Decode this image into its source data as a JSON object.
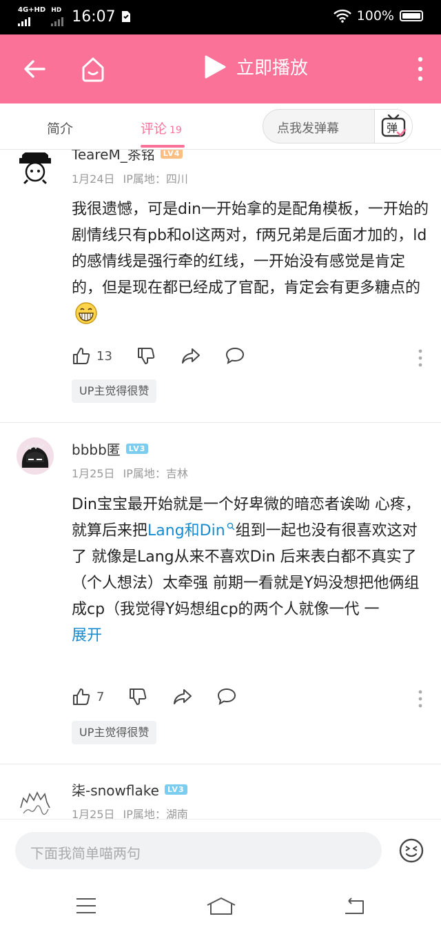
{
  "status_bar": {
    "network_label": "4G+HD",
    "network2_label": "HD",
    "time": "16:07",
    "battery": "100%"
  },
  "app_bar": {
    "play_label": "立即播放"
  },
  "tabs": {
    "intro": "简介",
    "comments": "评论",
    "comment_count": "19",
    "danmaku_placeholder": "点我发弹幕",
    "danmaku_icon_label": "弹"
  },
  "comments": [
    {
      "username": "TeareM_茶铭",
      "level": "LV4",
      "level_color": "#fcbf83",
      "date": "1月24日",
      "ip": "IP属地：四川",
      "text": "我很遗憾，可是din一开始拿的是配角模板，一开始的剧情线只有pb和ol这两对，f两兄弟是后面才加的，ld的感情线是强行牵的红线，一开始没有感觉是肯定的，但是现在都已经成了官配，肯定会有更多糖点的",
      "emoji": "grinning-emoji",
      "likes": "13",
      "badge": "UP主觉得很赞"
    },
    {
      "username": "bbbb匿",
      "level": "LV3",
      "level_color": "#7bcdef",
      "date": "1月25日",
      "ip": "IP属地：吉林",
      "text_before_link": "Din宝宝最开始就是一个好卑微的暗恋者诶呦 心疼，就算后来把",
      "link_text": "Lang和Din",
      "text_after_link": "组到一起也没有很喜欢这对了 就像是Lang从来不喜欢Din 后来表白都不真实了（个人想法）太牵强 前期一看就是Y妈没想把他俩组成cp（我觉得Y妈想组cp的两个人就像一代 一",
      "expand": "展开",
      "likes": "7",
      "badge": "UP主觉得很赞"
    },
    {
      "username": "柒-snowflake",
      "level": "LV3",
      "level_color": "#7bcdef",
      "date": "1月25日",
      "ip": "IP属地：湖南"
    }
  ],
  "input_bar": {
    "placeholder": "下面我简单喵两句"
  },
  "colors": {
    "accent": "#fb7299",
    "link": "#178bcf"
  }
}
